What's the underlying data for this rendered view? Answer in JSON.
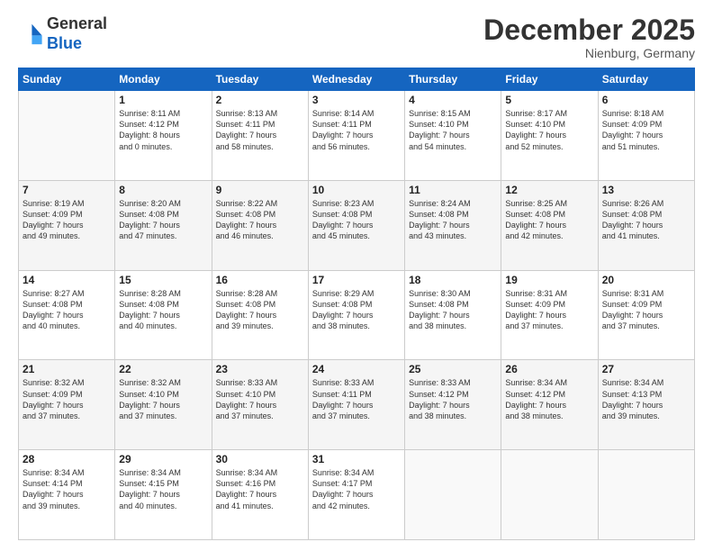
{
  "logo": {
    "line1": "General",
    "line2": "Blue"
  },
  "header": {
    "month": "December 2025",
    "location": "Nienburg, Germany"
  },
  "weekdays": [
    "Sunday",
    "Monday",
    "Tuesday",
    "Wednesday",
    "Thursday",
    "Friday",
    "Saturday"
  ],
  "weeks": [
    [
      {
        "day": "",
        "info": ""
      },
      {
        "day": "1",
        "info": "Sunrise: 8:11 AM\nSunset: 4:12 PM\nDaylight: 8 hours\nand 0 minutes."
      },
      {
        "day": "2",
        "info": "Sunrise: 8:13 AM\nSunset: 4:11 PM\nDaylight: 7 hours\nand 58 minutes."
      },
      {
        "day": "3",
        "info": "Sunrise: 8:14 AM\nSunset: 4:11 PM\nDaylight: 7 hours\nand 56 minutes."
      },
      {
        "day": "4",
        "info": "Sunrise: 8:15 AM\nSunset: 4:10 PM\nDaylight: 7 hours\nand 54 minutes."
      },
      {
        "day": "5",
        "info": "Sunrise: 8:17 AM\nSunset: 4:10 PM\nDaylight: 7 hours\nand 52 minutes."
      },
      {
        "day": "6",
        "info": "Sunrise: 8:18 AM\nSunset: 4:09 PM\nDaylight: 7 hours\nand 51 minutes."
      }
    ],
    [
      {
        "day": "7",
        "info": "Sunrise: 8:19 AM\nSunset: 4:09 PM\nDaylight: 7 hours\nand 49 minutes."
      },
      {
        "day": "8",
        "info": "Sunrise: 8:20 AM\nSunset: 4:08 PM\nDaylight: 7 hours\nand 47 minutes."
      },
      {
        "day": "9",
        "info": "Sunrise: 8:22 AM\nSunset: 4:08 PM\nDaylight: 7 hours\nand 46 minutes."
      },
      {
        "day": "10",
        "info": "Sunrise: 8:23 AM\nSunset: 4:08 PM\nDaylight: 7 hours\nand 45 minutes."
      },
      {
        "day": "11",
        "info": "Sunrise: 8:24 AM\nSunset: 4:08 PM\nDaylight: 7 hours\nand 43 minutes."
      },
      {
        "day": "12",
        "info": "Sunrise: 8:25 AM\nSunset: 4:08 PM\nDaylight: 7 hours\nand 42 minutes."
      },
      {
        "day": "13",
        "info": "Sunrise: 8:26 AM\nSunset: 4:08 PM\nDaylight: 7 hours\nand 41 minutes."
      }
    ],
    [
      {
        "day": "14",
        "info": "Sunrise: 8:27 AM\nSunset: 4:08 PM\nDaylight: 7 hours\nand 40 minutes."
      },
      {
        "day": "15",
        "info": "Sunrise: 8:28 AM\nSunset: 4:08 PM\nDaylight: 7 hours\nand 40 minutes."
      },
      {
        "day": "16",
        "info": "Sunrise: 8:28 AM\nSunset: 4:08 PM\nDaylight: 7 hours\nand 39 minutes."
      },
      {
        "day": "17",
        "info": "Sunrise: 8:29 AM\nSunset: 4:08 PM\nDaylight: 7 hours\nand 38 minutes."
      },
      {
        "day": "18",
        "info": "Sunrise: 8:30 AM\nSunset: 4:08 PM\nDaylight: 7 hours\nand 38 minutes."
      },
      {
        "day": "19",
        "info": "Sunrise: 8:31 AM\nSunset: 4:09 PM\nDaylight: 7 hours\nand 37 minutes."
      },
      {
        "day": "20",
        "info": "Sunrise: 8:31 AM\nSunset: 4:09 PM\nDaylight: 7 hours\nand 37 minutes."
      }
    ],
    [
      {
        "day": "21",
        "info": "Sunrise: 8:32 AM\nSunset: 4:09 PM\nDaylight: 7 hours\nand 37 minutes."
      },
      {
        "day": "22",
        "info": "Sunrise: 8:32 AM\nSunset: 4:10 PM\nDaylight: 7 hours\nand 37 minutes."
      },
      {
        "day": "23",
        "info": "Sunrise: 8:33 AM\nSunset: 4:10 PM\nDaylight: 7 hours\nand 37 minutes."
      },
      {
        "day": "24",
        "info": "Sunrise: 8:33 AM\nSunset: 4:11 PM\nDaylight: 7 hours\nand 37 minutes."
      },
      {
        "day": "25",
        "info": "Sunrise: 8:33 AM\nSunset: 4:12 PM\nDaylight: 7 hours\nand 38 minutes."
      },
      {
        "day": "26",
        "info": "Sunrise: 8:34 AM\nSunset: 4:12 PM\nDaylight: 7 hours\nand 38 minutes."
      },
      {
        "day": "27",
        "info": "Sunrise: 8:34 AM\nSunset: 4:13 PM\nDaylight: 7 hours\nand 39 minutes."
      }
    ],
    [
      {
        "day": "28",
        "info": "Sunrise: 8:34 AM\nSunset: 4:14 PM\nDaylight: 7 hours\nand 39 minutes."
      },
      {
        "day": "29",
        "info": "Sunrise: 8:34 AM\nSunset: 4:15 PM\nDaylight: 7 hours\nand 40 minutes."
      },
      {
        "day": "30",
        "info": "Sunrise: 8:34 AM\nSunset: 4:16 PM\nDaylight: 7 hours\nand 41 minutes."
      },
      {
        "day": "31",
        "info": "Sunrise: 8:34 AM\nSunset: 4:17 PM\nDaylight: 7 hours\nand 42 minutes."
      },
      {
        "day": "",
        "info": ""
      },
      {
        "day": "",
        "info": ""
      },
      {
        "day": "",
        "info": ""
      }
    ]
  ]
}
